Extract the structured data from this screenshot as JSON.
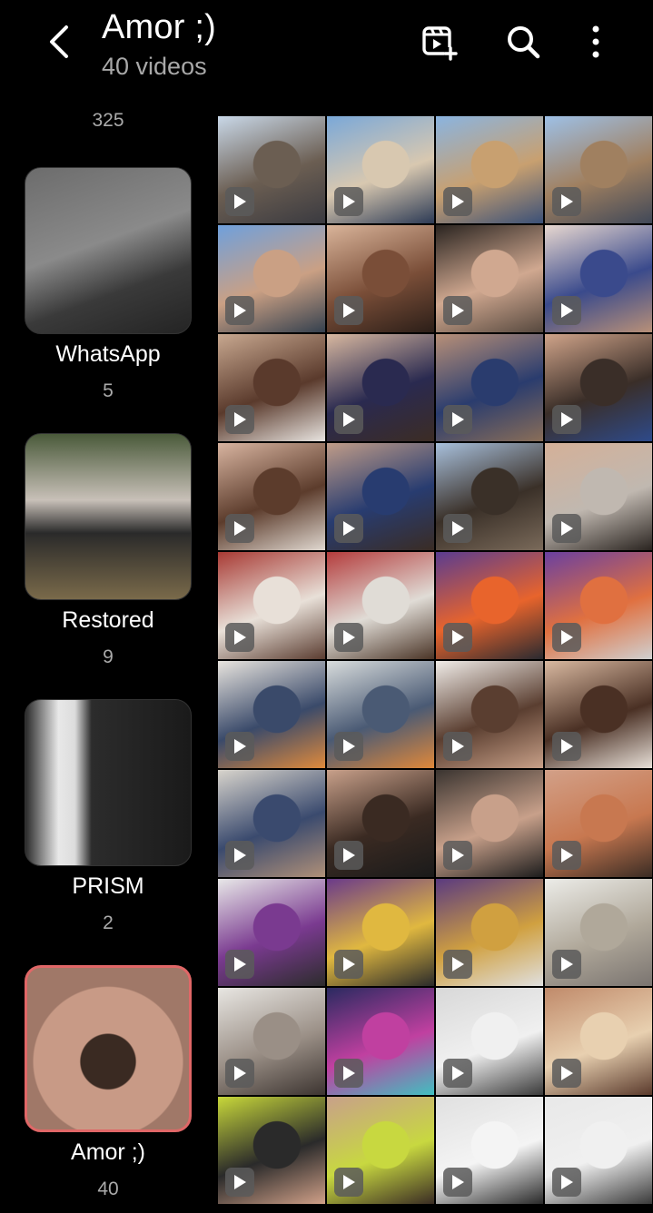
{
  "header": {
    "title": "Amor ;)",
    "subtitle": "40 videos",
    "icons": [
      "back-icon",
      "create-video-icon",
      "search-icon",
      "more-options-icon"
    ]
  },
  "sidebar": {
    "top_count": "325",
    "albums": [
      {
        "name": "WhatsApp",
        "count": "5",
        "selected": false
      },
      {
        "name": "Restored",
        "count": "9",
        "selected": false
      },
      {
        "name": "PRISM",
        "count": "2",
        "selected": false
      },
      {
        "name": "Amor ;)",
        "count": "40",
        "selected": true
      }
    ]
  },
  "grid": {
    "columns": 4,
    "video_count": 40,
    "palette": [
      [
        "#c9d8e8",
        "#6b5e52",
        "#3a3a40"
      ],
      [
        "#7aa8d8",
        "#d8c8b0",
        "#2c3a55"
      ],
      [
        "#8ab4e0",
        "#c8a070",
        "#3a5078"
      ],
      [
        "#9ec0e6",
        "#a08060",
        "#404858"
      ],
      [
        "#6fa0dc",
        "#caa084",
        "#34404e"
      ],
      [
        "#d9b49a",
        "#7a4e38",
        "#2b1e18"
      ],
      [
        "#2a2420",
        "#d0a890",
        "#56483e"
      ],
      [
        "#e8d8d0",
        "#3a4a8c",
        "#b89078"
      ],
      [
        "#c8a890",
        "#5a3a2c",
        "#e8e4e0"
      ],
      [
        "#d8b8a0",
        "#2a2a50",
        "#3c2c24"
      ],
      [
        "#b89078",
        "#2a3c6e",
        "#8a6e58"
      ],
      [
        "#d0a48a",
        "#3a2e28",
        "#2e4a8a"
      ],
      [
        "#d8b4a0",
        "#5c3c2c",
        "#e0d8d0"
      ],
      [
        "#c09c88",
        "#283c70",
        "#3a2c24"
      ],
      [
        "#a8c0dc",
        "#3a3028",
        "#7a6a5a"
      ],
      [
        "#d4b098",
        "#c0b8b0",
        "#2a2420"
      ],
      [
        "#a83a34",
        "#e8e0d8",
        "#5a3c30"
      ],
      [
        "#b43c3c",
        "#e0dcd6",
        "#4a3426"
      ],
      [
        "#5a3c90",
        "#e8642c",
        "#2a2a30"
      ],
      [
        "#6a40a0",
        "#e07040",
        "#d0d0d0"
      ],
      [
        "#e8e4de",
        "#3a4a6a",
        "#e08a3c"
      ],
      [
        "#d8dcdc",
        "#4a5a74",
        "#e0883a"
      ],
      [
        "#f0ece8",
        "#5a3e30",
        "#c8a088"
      ],
      [
        "#d8b8a0",
        "#4a3024",
        "#e8e0d8"
      ],
      [
        "#d8d4cc",
        "#3a4a6e",
        "#b09078"
      ],
      [
        "#c8a08a",
        "#3a2a22",
        "#1a1a1a"
      ],
      [
        "#3a3430",
        "#c8a08a",
        "#1c1c1c"
      ],
      [
        "#d2a088",
        "#c87850",
        "#3a2c24"
      ],
      [
        "#e8e8e8",
        "#7a3a90",
        "#2c2c2c"
      ],
      [
        "#6a3a8a",
        "#e0b840",
        "#2a2a2a"
      ],
      [
        "#5a3a80",
        "#d0a040",
        "#e0e0e0"
      ],
      [
        "#ecece8",
        "#b0a89a",
        "#7a7470"
      ],
      [
        "#e8e6e2",
        "#9a8f86",
        "#3c3430"
      ],
      [
        "#2a2a60",
        "#c040a0",
        "#40c0c0"
      ],
      [
        "#d8d8d8",
        "#f0f0f0",
        "#3a3a3a"
      ],
      [
        "#c08a6a",
        "#e8d0b0",
        "#5a3a2c"
      ],
      [
        "#c8d83a",
        "#2a2a2a",
        "#d0a088"
      ],
      [
        "#c8a08a",
        "#c8d840",
        "#3a2c24"
      ],
      [
        "#e0e0e0",
        "#f4f4f4",
        "#2a2a2a"
      ],
      [
        "#e8e8e8",
        "#f0f0f0",
        "#3a3a3a"
      ]
    ]
  }
}
